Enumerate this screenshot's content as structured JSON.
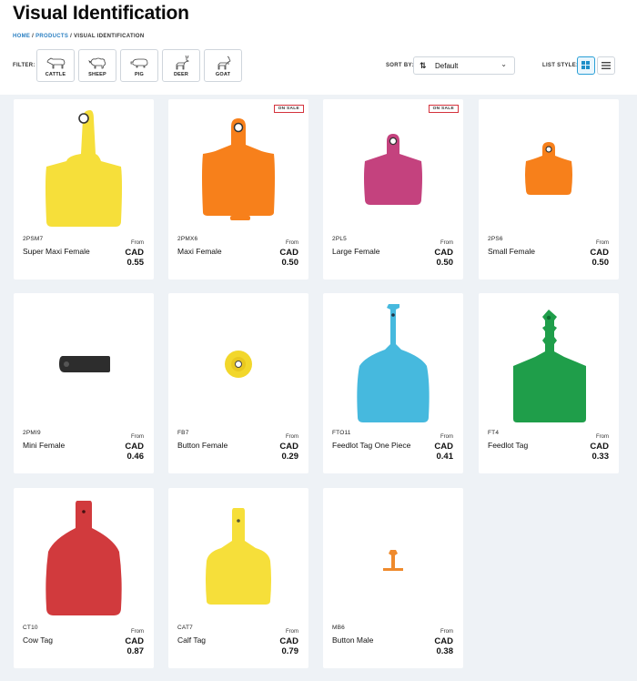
{
  "page": {
    "title": "Visual Identification"
  },
  "breadcrumb": {
    "home": "HOME",
    "sep1": " / ",
    "products": "PRODUCTS",
    "sep2": " / ",
    "current": "VISUAL IDENTIFICATION"
  },
  "filter": {
    "label": "FILTER:",
    "options": [
      {
        "label": "CATTLE",
        "icon": "cow-icon"
      },
      {
        "label": "SHEEP",
        "icon": "sheep-icon"
      },
      {
        "label": "PIG",
        "icon": "pig-icon"
      },
      {
        "label": "DEER",
        "icon": "deer-icon"
      },
      {
        "label": "GOAT",
        "icon": "goat-icon"
      }
    ]
  },
  "sort": {
    "label": "SORT BY:",
    "value": "Default",
    "icon": "sort-order-icon"
  },
  "list_style": {
    "label": "LIST STYLE:",
    "active": "grid"
  },
  "badges": {
    "on_sale": "ON SALE"
  },
  "price_prefix": "From",
  "currency": "CAD",
  "products": [
    {
      "sku": "2PSM7",
      "name": "Super Maxi Female",
      "price": "0.55",
      "color": "#f6df3a",
      "on_sale": false
    },
    {
      "sku": "2PMX6",
      "name": "Maxi Female",
      "price": "0.50",
      "color": "#f7801b",
      "on_sale": true
    },
    {
      "sku": "2PL5",
      "name": "Large Female",
      "price": "0.50",
      "color": "#c4427e",
      "on_sale": true
    },
    {
      "sku": "2PS6",
      "name": "Small Female",
      "price": "0.50",
      "color": "#f7801b",
      "on_sale": false
    },
    {
      "sku": "2PMI9",
      "name": "Mini Female",
      "price": "0.46",
      "color": "#2d2d2d",
      "on_sale": false
    },
    {
      "sku": "FB7",
      "name": "Button Female",
      "price": "0.29",
      "color": "#f2d72b",
      "on_sale": false
    },
    {
      "sku": "FTO11",
      "name": "Feedlot Tag One Piece",
      "price": "0.41",
      "color": "#46b9de",
      "on_sale": false
    },
    {
      "sku": "FT4",
      "name": "Feedlot Tag",
      "price": "0.33",
      "color": "#1f9e4a",
      "on_sale": false
    },
    {
      "sku": "CT10",
      "name": "Cow Tag",
      "price": "0.87",
      "color": "#d13a3d",
      "on_sale": false
    },
    {
      "sku": "CAT7",
      "name": "Calf Tag",
      "price": "0.79",
      "color": "#f6df3a",
      "on_sale": false
    },
    {
      "sku": "MB6",
      "name": "Button Male",
      "price": "0.38",
      "color": "#ef8a2c",
      "on_sale": false
    }
  ]
}
